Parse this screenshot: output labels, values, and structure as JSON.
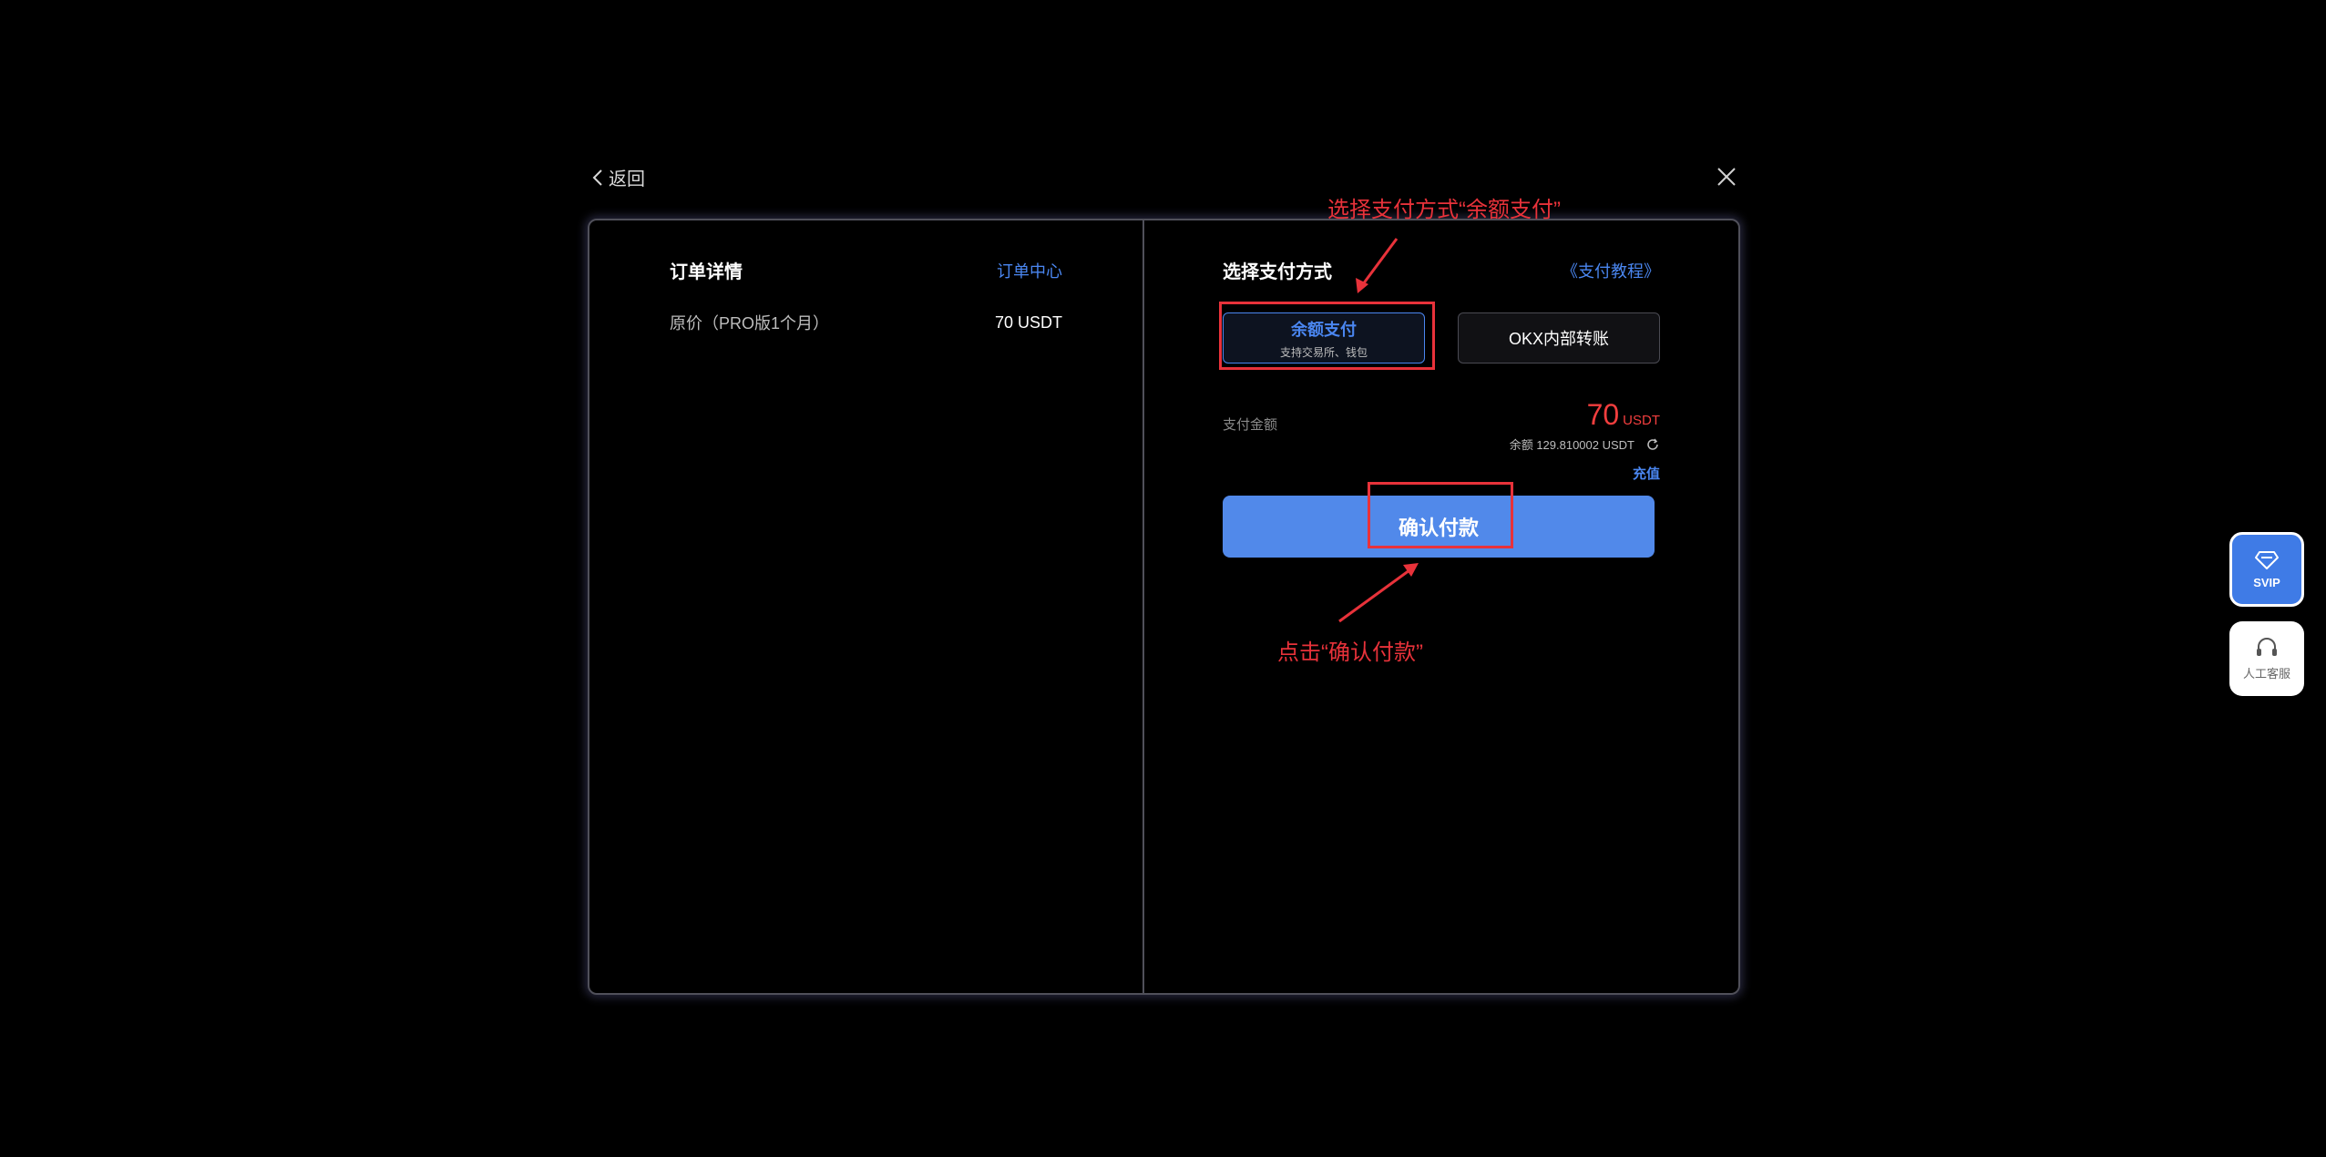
{
  "top": {
    "back_label": "返回"
  },
  "order": {
    "title": "订单详情",
    "order_center_link": "订单中心",
    "line_label": "原价（PRO版1个月）",
    "line_value": "70 USDT"
  },
  "payment": {
    "title": "选择支付方式",
    "tutorial_link": "《支付教程》",
    "option_balance_label": "余额支付",
    "option_balance_sub": "支持交易所、钱包",
    "option_okx_label": "OKX内部转账",
    "amount_label": "支付金额",
    "amount_value": "70",
    "amount_unit": "USDT",
    "balance_text": "余额 129.810002 USDT",
    "recharge_link": "充值",
    "confirm_label": "确认付款"
  },
  "annotations": {
    "top_note": "选择支付方式“余额支付”",
    "bottom_note": "点击“确认付款”"
  },
  "side": {
    "svip_label": "SVIP",
    "service_label": "人工客服"
  },
  "colors": {
    "accent": "#4a86f0",
    "confirm_button": "#5189ea",
    "amount_red": "#f23e3e",
    "annotation_red": "#e8323a"
  }
}
